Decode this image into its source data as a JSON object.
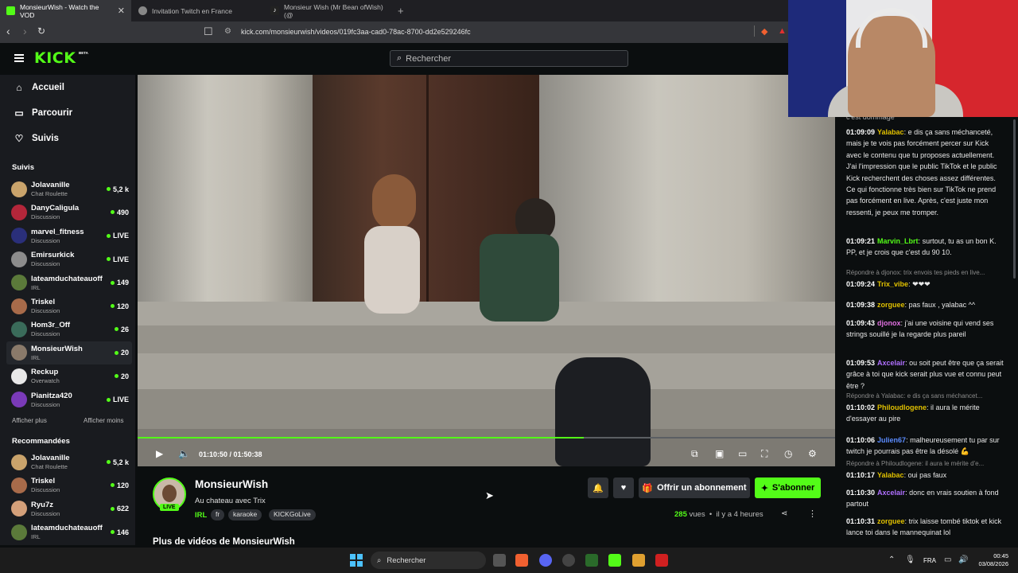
{
  "browser": {
    "tabs": [
      {
        "label": "MonsieurWish - Watch the VOD",
        "active": true
      },
      {
        "label": "Invitation Twitch en France",
        "active": false
      },
      {
        "label": "Monsieur Wish (Mr Bean ofWish) (@",
        "active": false
      }
    ],
    "url": "kick.com/monsieurwish/videos/019fc3aa-cad0-78ac-8700-dd2e529246fc"
  },
  "header": {
    "logo": "KICK",
    "beta": "BETA",
    "search_placeholder": "Rechercher"
  },
  "sidebar": {
    "nav": [
      {
        "label": "Accueil",
        "icon": "home-icon"
      },
      {
        "label": "Parcourir",
        "icon": "browse-icon"
      },
      {
        "label": "Suivis",
        "icon": "heart-icon"
      }
    ],
    "followed_title": "Suivis",
    "followed": [
      {
        "name": "Jolavanille",
        "category": "Chat Roulette",
        "viewers": "5,2 k",
        "color": "#c9a36b"
      },
      {
        "name": "DanyCaligula",
        "category": "Discussion",
        "viewers": "490",
        "color": "#b3263a"
      },
      {
        "name": "marvel_fitness",
        "category": "Discussion",
        "viewers": "LIVE",
        "color": "#2a2f7a"
      },
      {
        "name": "Emirsurkick",
        "category": "Discussion",
        "viewers": "LIVE",
        "color": "#8c8c8c"
      },
      {
        "name": "lateamduchateauoff",
        "category": "IRL",
        "viewers": "149",
        "color": "#5b7a3a"
      },
      {
        "name": "Triskel",
        "category": "Discussion",
        "viewers": "120",
        "color": "#a86b4a"
      },
      {
        "name": "Hom3r_Off",
        "category": "Discussion",
        "viewers": "26",
        "color": "#3a6b5a"
      },
      {
        "name": "MonsieurWish",
        "category": "IRL",
        "viewers": "20",
        "color": "#8a7a6a",
        "selected": true
      },
      {
        "name": "Reckup",
        "category": "Overwatch",
        "viewers": "20",
        "color": "#e8e8e8"
      },
      {
        "name": "Pianitza420",
        "category": "Discussion",
        "viewers": "LIVE",
        "color": "#7a3ab8"
      }
    ],
    "show_more": "Afficher plus",
    "show_less": "Afficher moins",
    "recommended_title": "Recommandées",
    "recommended": [
      {
        "name": "Jolavanille",
        "category": "Chat Roulette",
        "viewers": "5,2 k",
        "color": "#c9a36b"
      },
      {
        "name": "Triskel",
        "category": "Discussion",
        "viewers": "120",
        "color": "#a86b4a"
      },
      {
        "name": "Ryu7z",
        "category": "Discussion",
        "viewers": "622",
        "color": "#d4a07a"
      },
      {
        "name": "lateamduchateauoff",
        "category": "IRL",
        "viewers": "146",
        "color": "#5b7a3a"
      }
    ]
  },
  "player": {
    "time": "01:10:50 / 01:50:38",
    "progress": 0.64
  },
  "stream": {
    "name": "MonsieurWish",
    "title": "Au chateau avec Trix",
    "live_badge": "LIVE",
    "category": "IRL",
    "tags": [
      "fr",
      "karaoke",
      "KICKGoLive"
    ],
    "gift_label": "Offrir un abonnement",
    "subscribe_label": "S'abonner",
    "views_count": "285",
    "views_label": "vues",
    "ago": "il y a 4 heures",
    "more_videos": "Plus de vidéos de MonsieurWish"
  },
  "chat": {
    "messages": [
      {
        "time": "01:09:09",
        "user": "Yalabac",
        "color": "#e0c000",
        "text": "e dis ça sans méchanceté, mais je te vois pas forcément percer sur Kick avec le contenu que tu proposes actuellement. J'ai l'impression que le public TikTok et le public Kick recherchent des choses assez différentes. Ce qui fonctionne très bien sur TikTok ne prend pas forcément en live. Après, c'est juste mon ressenti, je peux me tromper."
      },
      {
        "time": "01:09:21",
        "user": "Marvin_Lbrt",
        "color": "#53fc18",
        "text": "surtout, tu as un bon K. PP, et je crois que c'est du 90 10."
      },
      {
        "time": "01:09:24",
        "user": "Trix_vibe",
        "color": "#e0c000",
        "text": "❤❤❤",
        "reply": "Répondre à djonox: trix envois tes pieds en live..."
      },
      {
        "time": "01:09:38",
        "user": "zorguee",
        "color": "#e0c000",
        "text": "pas faux , yalabac ^^"
      },
      {
        "time": "01:09:43",
        "user": "djonox",
        "color": "#e070e0",
        "text": "j'ai une voisine qui vend ses strings souillé je la regarde plus pareil"
      },
      {
        "time": "01:09:53",
        "user": "Axcelair",
        "color": "#b070ff",
        "text": "ou soit peut être que ça serait grâce à toi que kick serait plus vue et connu peut être ?"
      },
      {
        "time": "01:10:02",
        "user": "Philoudlogene",
        "color": "#e0c000",
        "text": "il aura le mérite d'essayer au pire",
        "reply": "Répondre à Yalabac: e dis ça sans méchancet..."
      },
      {
        "time": "01:10:06",
        "user": "Julien67",
        "color": "#5b8cff",
        "text": "malheureusement tu par sur twitch je pourrais pas être la désolé 💪"
      },
      {
        "time": "01:10:17",
        "user": "Yalabac",
        "color": "#e0c000",
        "text": "oui pas faux",
        "reply": "Répondre à Philoudlogene: il aura le mérite d'e..."
      },
      {
        "time": "01:10:30",
        "user": "Axcelair",
        "color": "#b070ff",
        "text": "donc en vrais soutien à fond partout"
      },
      {
        "time": "01:10:31",
        "user": "zorguee",
        "color": "#e0c000",
        "text": "trix laisse tombé tiktok et kick lance toi dans le mannequinat lol"
      }
    ],
    "top_cut": "c'est dommage"
  },
  "taskbar": {
    "search": "Rechercher",
    "lang": "FRA",
    "time": "00:45",
    "date": "03/08/2026"
  }
}
